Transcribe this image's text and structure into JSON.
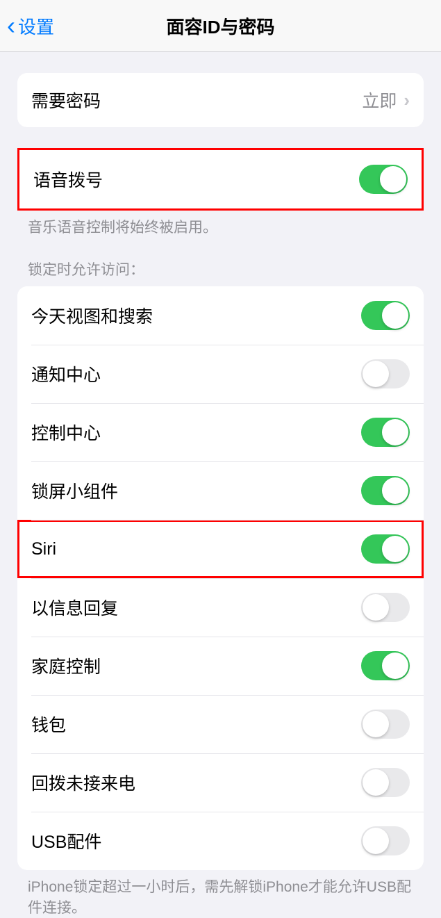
{
  "header": {
    "back_label": "设置",
    "title": "面容ID与密码"
  },
  "passcode_section": {
    "require_passcode": {
      "label": "需要密码",
      "value": "立即"
    }
  },
  "voice_dial_section": {
    "voice_dial": {
      "label": "语音拨号",
      "enabled": true
    },
    "footer": "音乐语音控制将始终被启用。"
  },
  "lock_access_section": {
    "header": "锁定时允许访问：",
    "items": [
      {
        "label": "今天视图和搜索",
        "enabled": true,
        "highlighted": false
      },
      {
        "label": "通知中心",
        "enabled": false,
        "highlighted": false
      },
      {
        "label": "控制中心",
        "enabled": true,
        "highlighted": false
      },
      {
        "label": "锁屏小组件",
        "enabled": true,
        "highlighted": false
      },
      {
        "label": "Siri",
        "enabled": true,
        "highlighted": true
      },
      {
        "label": "以信息回复",
        "enabled": false,
        "highlighted": false
      },
      {
        "label": "家庭控制",
        "enabled": true,
        "highlighted": false
      },
      {
        "label": "钱包",
        "enabled": false,
        "highlighted": false
      },
      {
        "label": "回拨未接来电",
        "enabled": false,
        "highlighted": false
      },
      {
        "label": "USB配件",
        "enabled": false,
        "highlighted": false
      }
    ],
    "footer": "iPhone锁定超过一小时后，需先解锁iPhone才能允许USB配件连接。"
  }
}
